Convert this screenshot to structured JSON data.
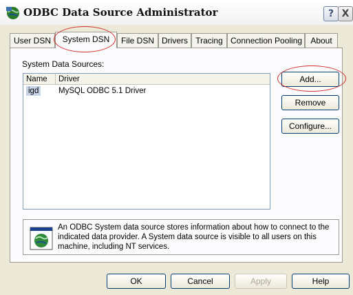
{
  "window": {
    "title": "ODBC Data Source Administrator",
    "help_symbol": "?",
    "close_symbol": "X"
  },
  "tabs": [
    {
      "label": "User DSN"
    },
    {
      "label": "System DSN"
    },
    {
      "label": "File DSN"
    },
    {
      "label": "Drivers"
    },
    {
      "label": "Tracing"
    },
    {
      "label": "Connection Pooling"
    },
    {
      "label": "About"
    }
  ],
  "active_tab": "System DSN",
  "panel": {
    "section_label": "System Data Sources:",
    "columns": [
      "Name",
      "Driver"
    ],
    "rows": [
      {
        "name": "igd",
        "driver": "MySQL ODBC 5.1 Driver"
      }
    ]
  },
  "side_buttons": {
    "add": "Add...",
    "remove": "Remove",
    "configure": "Configure..."
  },
  "info": {
    "text": "An ODBC System data source stores information about how to connect to the indicated data provider.  A System data source is visible to all users on this machine, including NT services."
  },
  "footer_buttons": {
    "ok": "OK",
    "cancel": "Cancel",
    "apply": "Apply",
    "help": "Help"
  },
  "colors": {
    "window_bg": "#ece9d8",
    "annotation_red": "#d42a2a",
    "selection": "#c8d4e8"
  }
}
